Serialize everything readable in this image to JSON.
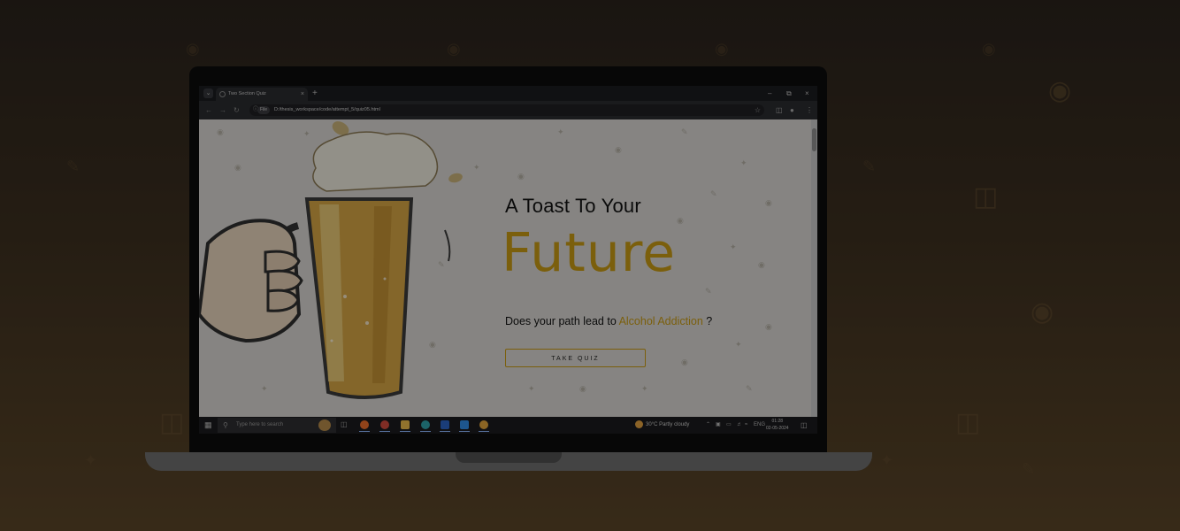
{
  "browser": {
    "tab_title": "Two Section Quiz",
    "url_chip": "File",
    "url": "D:/thesis_workspace/code/attempt_5/quiz05.html"
  },
  "hero": {
    "line1": "A Toast To Your",
    "line2": "Future",
    "question_prefix": "Does your path lead to ",
    "question_accent": "Alcohol Addiction",
    "question_suffix": " ?",
    "button_label": "TAKE QUIZ"
  },
  "taskbar": {
    "search_placeholder": "Type here to search",
    "weather": "30°C  Partly cloudy",
    "language": "ENG",
    "time": "01:28",
    "date": "02-05-2024"
  },
  "colors": {
    "accent": "#c79a14",
    "backdrop": "#3d3020"
  }
}
